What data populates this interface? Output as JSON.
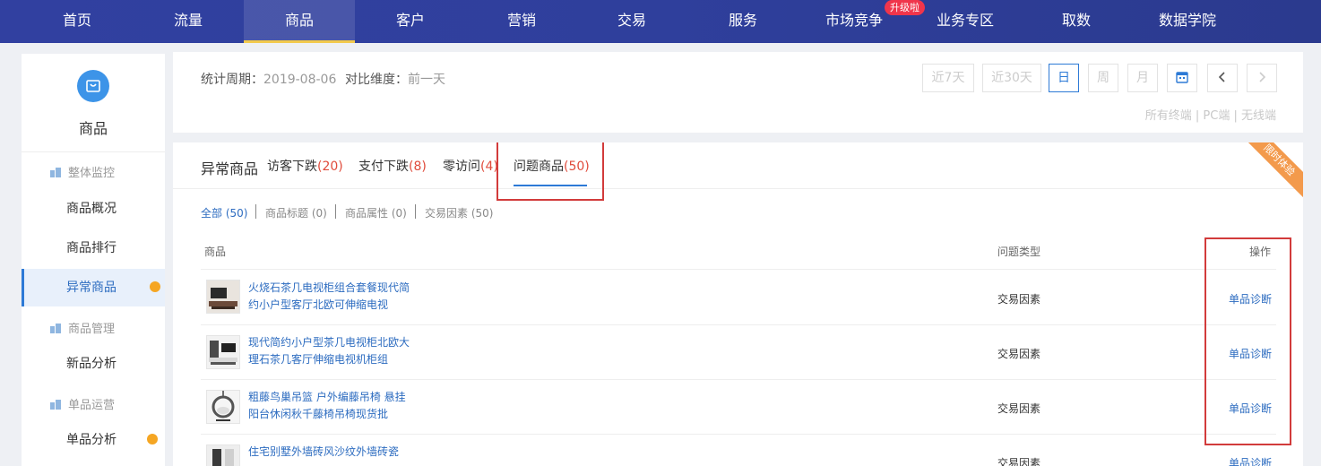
{
  "nav": {
    "items": [
      "首页",
      "流量",
      "商品",
      "客户",
      "营销",
      "交易",
      "服务",
      "市场竞争",
      "业务专区",
      "取数",
      "数据学院"
    ],
    "active_index": 2,
    "badge": "升级啦"
  },
  "sidebar": {
    "title": "商品",
    "groups": [
      {
        "label": "整体监控",
        "items": [
          "商品概况",
          "商品排行",
          "异常商品"
        ]
      },
      {
        "label": "商品管理",
        "items": [
          "新品分析"
        ]
      },
      {
        "label": "单品运营",
        "items": [
          "单品分析"
        ]
      }
    ],
    "active_item": "异常商品"
  },
  "filter": {
    "period_label": "统计周期：",
    "period_value": "2019-08-06",
    "compare_label": "对比维度：",
    "compare_value": "前一天",
    "buttons": [
      "近7天",
      "近30天",
      "日",
      "周",
      "月"
    ],
    "active_button": "日",
    "terminals": "所有终端 | PC端 | 无线端"
  },
  "main": {
    "title": "异常商品",
    "tabs": [
      {
        "label": "访客下跌",
        "count": "(20)"
      },
      {
        "label": "支付下跌",
        "count": "(8)"
      },
      {
        "label": "零访问",
        "count": "(4)"
      },
      {
        "label": "问题商品",
        "count": "(50)"
      }
    ],
    "active_tab": "问题商品",
    "ribbon": "限时体验",
    "subfilters": [
      "全部 (50)",
      "商品标题 (0)",
      "商品属性 (0)",
      "交易因素 (50)"
    ],
    "columns": {
      "product": "商品",
      "type": "问题类型",
      "action": "操作"
    },
    "rows": [
      {
        "name": "火烧石茶几电视柜组合套餐现代简约小户型客厅北欧可伸缩电视",
        "type": "交易因素",
        "action": "单品诊断"
      },
      {
        "name": "现代简约小户型茶几电视柜北欧大理石茶几客厅伸缩电视机柜组",
        "type": "交易因素",
        "action": "单品诊断"
      },
      {
        "name": "粗藤鸟巢吊篮 户外编藤吊椅 悬挂阳台休闲秋千藤椅吊椅现货批",
        "type": "交易因素",
        "action": "单品诊断"
      },
      {
        "name": "住宅别墅外墙砖风沙纹外墙砖瓷",
        "type": "交易因素",
        "action": "单品诊断"
      }
    ]
  }
}
